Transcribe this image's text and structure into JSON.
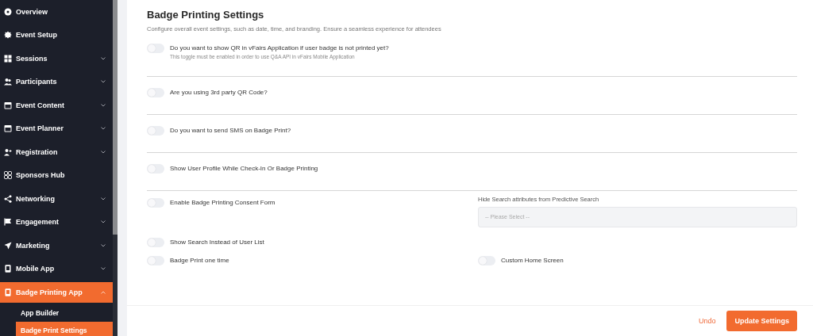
{
  "sidebar": {
    "items": [
      {
        "label": "Overview",
        "selected": false
      },
      {
        "label": "Event Setup",
        "selected": false
      },
      {
        "label": "Sessions",
        "selected": false,
        "expanded": false
      },
      {
        "label": "Participants",
        "selected": false,
        "expanded": false
      },
      {
        "label": "Event Content",
        "selected": false,
        "expanded": false
      },
      {
        "label": "Event Planner",
        "selected": false,
        "expanded": false
      },
      {
        "label": "Registration",
        "selected": false,
        "expanded": false
      },
      {
        "label": "Sponsors Hub",
        "selected": false
      },
      {
        "label": "Networking",
        "selected": false,
        "expanded": false
      },
      {
        "label": "Engagement",
        "selected": false,
        "expanded": false
      },
      {
        "label": "Marketing",
        "selected": false,
        "expanded": false
      },
      {
        "label": "Mobile App",
        "selected": false,
        "expanded": false
      },
      {
        "label": "Badge Printing App",
        "selected": true,
        "expanded": true,
        "children": [
          {
            "label": "App Builder",
            "selected": false
          },
          {
            "label": "Badge Print Settings",
            "selected": true
          }
        ]
      }
    ]
  },
  "page": {
    "title": "Badge Printing Settings",
    "description": "Configure overall event settings, such as date, time, and branding. Ensure a seamless experience for attendees"
  },
  "sections": [
    {
      "rows": [
        {
          "left": {
            "kind": "toggle",
            "label": "Do you want to show QR in vFairs Application if user badge is not printed yet?",
            "note": "This toggle must be enabled in order to use Q&A API in vFairs Mobile Application",
            "on": false
          }
        }
      ]
    },
    {
      "rows": [
        {
          "left": {
            "kind": "toggle",
            "label": "Are you using 3rd party QR Code?",
            "on": false
          }
        }
      ]
    },
    {
      "rows": [
        {
          "left": {
            "kind": "toggle",
            "label": "Do you want to send SMS on Badge Print?",
            "on": false
          }
        }
      ]
    },
    {
      "rows": [
        {
          "left": {
            "kind": "toggle",
            "label": "Show User Profile While Check-In Or Badge Printing",
            "on": false
          }
        }
      ]
    },
    {
      "rows": [
        {
          "left": {
            "kind": "toggle",
            "label": "Enable Badge Printing Consent Form",
            "on": false
          },
          "right": {
            "kind": "select",
            "label": "Hide Search attributes from Predictive Search",
            "placeholder": "-- Please Select --"
          }
        },
        {
          "left": {
            "kind": "toggle",
            "label": "Show Search Instead of User List",
            "on": false
          }
        },
        {
          "left": {
            "kind": "toggle",
            "label": "Badge Print one time",
            "on": false
          },
          "right": {
            "kind": "toggle",
            "label": "Custom Home Screen",
            "on": false
          }
        }
      ]
    }
  ],
  "footer": {
    "undo": "Undo",
    "submit": "Update Settings"
  }
}
